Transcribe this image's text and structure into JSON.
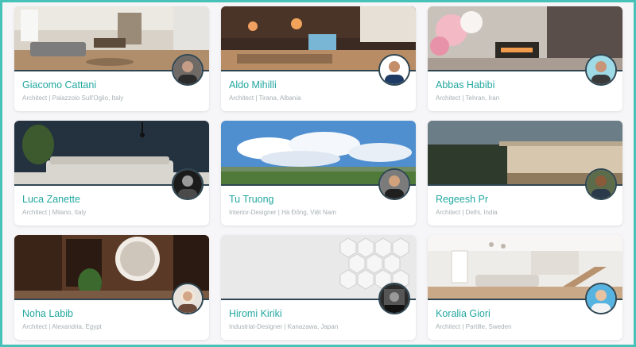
{
  "accent_color": "#22a79f",
  "frame_color": "#47c2b9",
  "profiles": [
    {
      "name": "Giacomo Cattani",
      "meta": "Architect | Palazzolo Sull'Oglio, Italy"
    },
    {
      "name": "Aldo Mihilli",
      "meta": "Architect | Tirana, Albania"
    },
    {
      "name": "Abbas Habibi",
      "meta": "Architect | Tehran, Iran"
    },
    {
      "name": "Luca Zanette",
      "meta": "Architect | Milano, Italy"
    },
    {
      "name": "Tu Truong",
      "meta": "Interior-Designer | Hà Đông, Việt Nam"
    },
    {
      "name": "Regeesh Pr",
      "meta": "Architect | Delhi, India"
    },
    {
      "name": "Noha Labib",
      "meta": "Architect | Alexandria, Egypt"
    },
    {
      "name": "Hiromi Kiriki",
      "meta": "Industrial-Designer | Kanazawa, Japan"
    },
    {
      "name": "Koralia Giori",
      "meta": "Architect | Partille, Sweden"
    }
  ]
}
